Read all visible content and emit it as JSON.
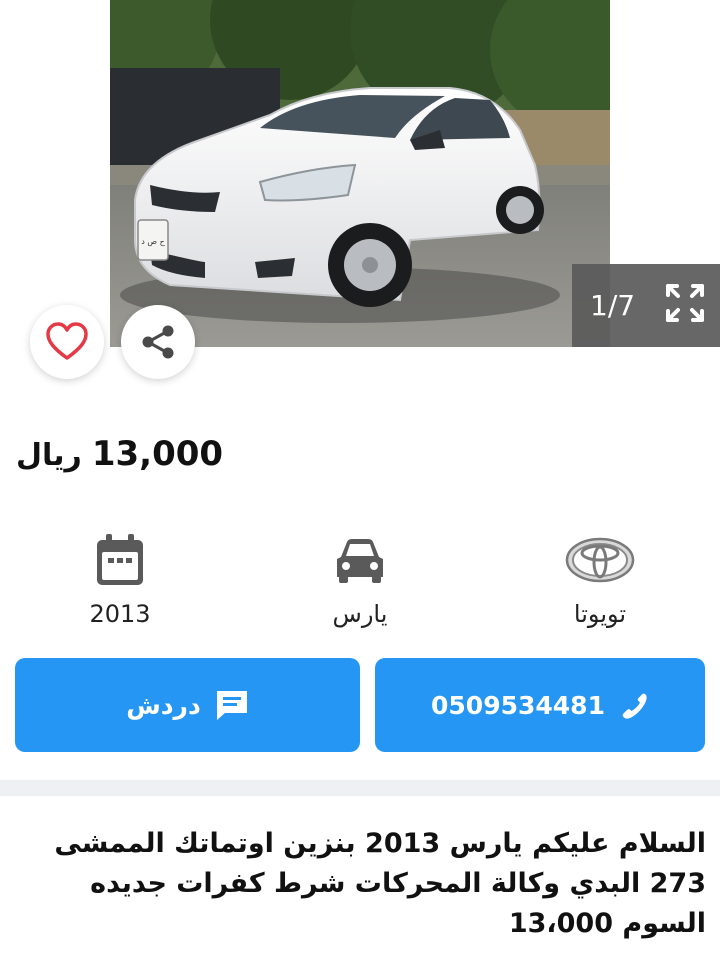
{
  "gallery": {
    "counter": "1/7",
    "plate_text": "ح ص د"
  },
  "listing": {
    "price_value": "13,000",
    "price_currency": "ريال"
  },
  "specs": {
    "year": "2013",
    "model": "يارس",
    "make": "تويوتا"
  },
  "actions": {
    "chat_label": "دردش",
    "phone_label": "0509534481"
  },
  "description": {
    "text": "السلام عليكم يارس 2013 بنزين اوتماتك الممشى 273 البدي وكالة المحركات شرط كفرات جديده السوم 13،000"
  },
  "colors": {
    "primary_button": "#2596f3",
    "heart": "#e53945",
    "icon_gray": "#5a5a5a"
  },
  "icons": [
    "chevron-left-icon",
    "chevron-right-icon",
    "fullscreen-icon",
    "heart-icon",
    "share-icon",
    "calendar-icon",
    "car-icon",
    "toyota-logo-icon",
    "chat-icon",
    "phone-icon"
  ]
}
